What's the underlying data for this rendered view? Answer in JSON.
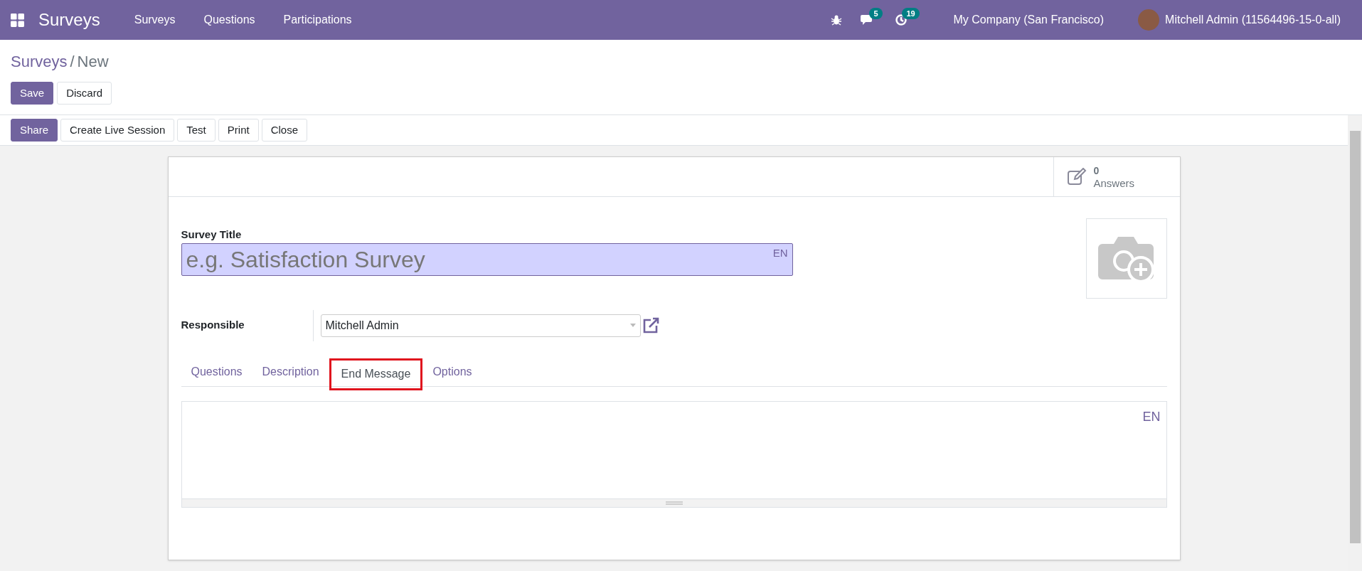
{
  "navbar": {
    "app_name": "Surveys",
    "menu": [
      "Surveys",
      "Questions",
      "Participations"
    ],
    "messages_count": "5",
    "activities_count": "19",
    "company": "My Company (San Francisco)",
    "user": "Mitchell Admin (11564496-15-0-all)"
  },
  "breadcrumb_separator": "/",
  "breadcrumb": [
    {
      "label": "Surveys",
      "kind": "link"
    },
    {
      "label": "New",
      "kind": "current"
    }
  ],
  "form_buttons": [
    {
      "label": "Save",
      "kind": "primary"
    },
    {
      "label": "Discard",
      "kind": "secondary"
    }
  ],
  "header_buttons": [
    {
      "label": "Share",
      "kind": "primary"
    },
    {
      "label": "Create Live Session",
      "kind": "secondary"
    },
    {
      "label": "Test",
      "kind": "secondary"
    },
    {
      "label": "Print",
      "kind": "secondary"
    },
    {
      "label": "Close",
      "kind": "secondary"
    }
  ],
  "stat_button": {
    "value": "0",
    "label": "Answers"
  },
  "title_field": {
    "label": "Survey Title",
    "placeholder": "e.g. Satisfaction Survey",
    "lang": "EN"
  },
  "responsible": {
    "label": "Responsible",
    "value": "Mitchell Admin"
  },
  "tabs": [
    {
      "label": "Questions",
      "selected": false
    },
    {
      "label": "Description",
      "selected": false
    },
    {
      "label": "End Message",
      "selected": true
    },
    {
      "label": "Options",
      "selected": false
    }
  ],
  "editor": {
    "lang": "EN"
  }
}
